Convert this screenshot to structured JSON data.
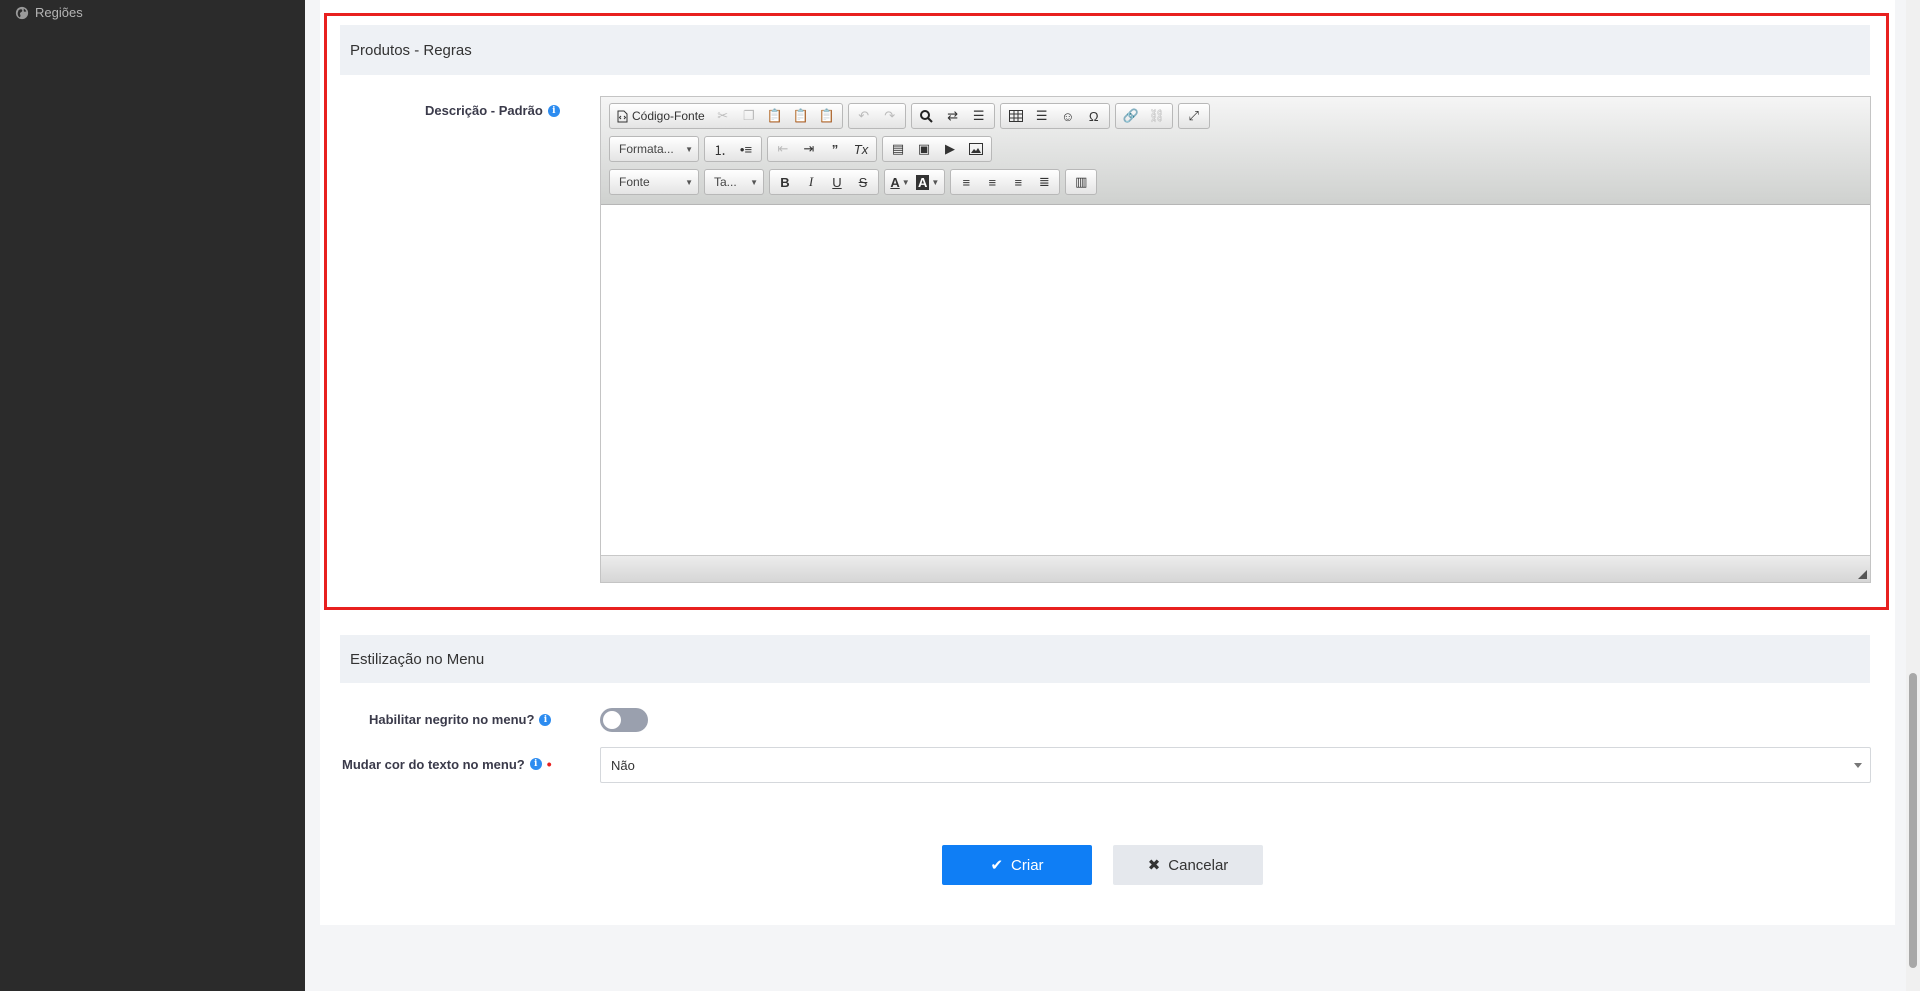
{
  "sidebar": {
    "items": [
      {
        "label": "Regiões",
        "icon": "globe-icon"
      }
    ]
  },
  "section_rules": {
    "title": "Produtos - Regras",
    "description_label": "Descrição - Padrão"
  },
  "editor": {
    "toolbar": {
      "source_label": "Código-Fonte",
      "format_label": "Formata...",
      "font_label": "Fonte",
      "size_label": "Ta...",
      "bold": "B",
      "italic": "I",
      "underline": "U",
      "strike": "S",
      "text_color": "A",
      "bg_color": "A",
      "special_char": "Ω"
    },
    "content": ""
  },
  "section_menu": {
    "title": "Estilização no Menu",
    "bold_label": "Habilitar negrito no menu?",
    "bold_enabled": false,
    "color_label": "Mudar cor do texto no menu?",
    "color_value": "Não"
  },
  "actions": {
    "create_label": "Criar",
    "cancel_label": "Cancelar"
  },
  "colors": {
    "primary": "#0f7ef5",
    "highlight_border": "#e8201f",
    "sidebar_bg": "#2b2b2b",
    "info": "#2d8cf0"
  }
}
